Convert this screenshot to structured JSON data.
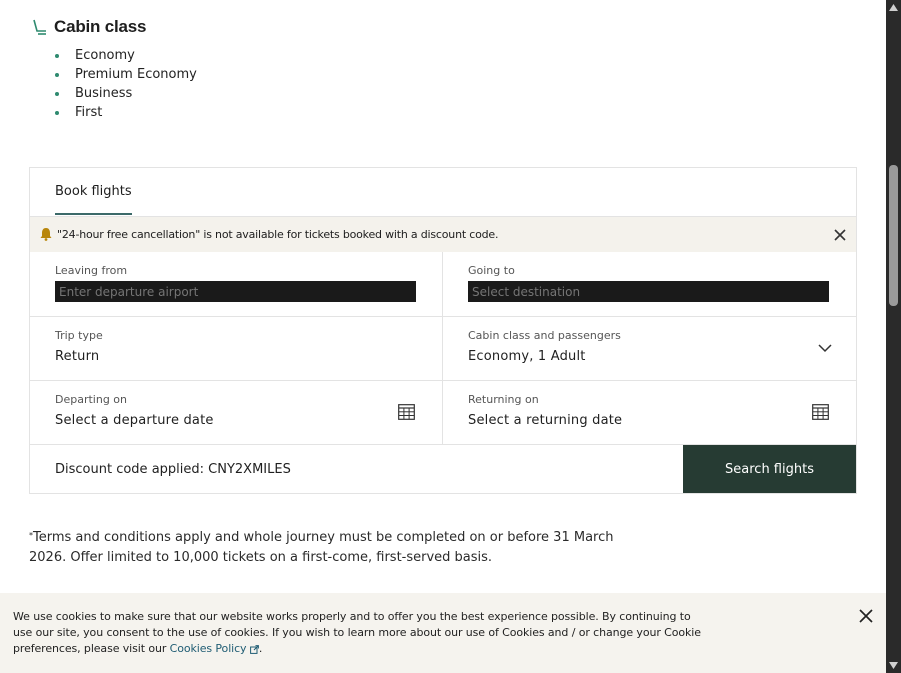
{
  "cabin_section": {
    "title": "Cabin class",
    "items": [
      "Economy",
      "Premium Economy",
      "Business",
      "First"
    ]
  },
  "booking": {
    "tab_label": "Book flights",
    "notice": "\"24-hour free cancellation\" is not available for tickets booked with a discount code.",
    "leaving_from": {
      "label": "Leaving from",
      "placeholder": "Enter departure airport"
    },
    "going_to": {
      "label": "Going to",
      "placeholder": "Select destination"
    },
    "trip_type": {
      "label": "Trip type",
      "value": "Return"
    },
    "cabin_passengers": {
      "label": "Cabin class and passengers",
      "value": "Economy, 1 Adult"
    },
    "departing": {
      "label": "Departing on",
      "value": "Select a departure date"
    },
    "returning": {
      "label": "Returning on",
      "value": "Select a returning date"
    },
    "discount_text": "Discount code applied: CNY2XMILES",
    "search_button": "Search flights"
  },
  "terms": {
    "marker": "*",
    "text": "Terms and conditions apply and whole journey must be completed on or before 31 March 2026. Offer limited to 10,000 tickets on a first-come, first-served basis."
  },
  "cookie": {
    "text": "We use cookies to make sure that our website works properly and to offer you the best experience possible. By continuing to use our site, you consent to the use of cookies. If you wish to learn more about our use of Cookies and / or change your Cookie preferences, please visit our ",
    "link": "Cookies Policy",
    "suffix": "."
  },
  "colors": {
    "accent_green": "#263b33",
    "tab_underline": "#3c6a69",
    "bullet": "#2e8a6f",
    "notice_bg": "#f4f2ec",
    "bell": "#b8860b",
    "cookie_link": "#1f5c73"
  },
  "icons": [
    "seat-icon",
    "bell-icon",
    "close-icon",
    "chevron-down-icon",
    "calendar-icon",
    "external-link-icon"
  ]
}
